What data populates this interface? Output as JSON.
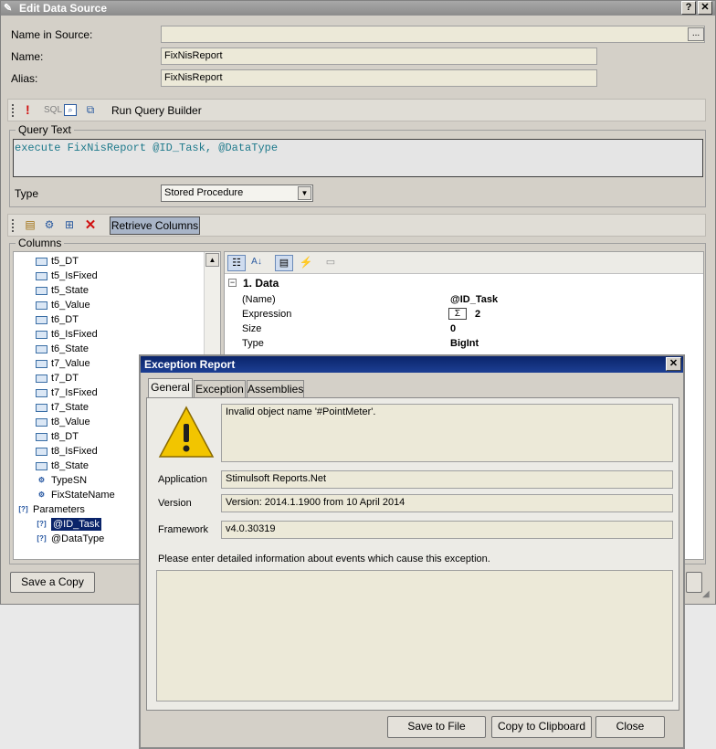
{
  "window": {
    "title": "Edit Data Source",
    "help_glyph": "?",
    "close_glyph": "✕"
  },
  "form": {
    "name_in_source_label": "Name in Source:",
    "name_in_source_value": "",
    "name_label": "Name:",
    "name_value": "FixNisReport",
    "alias_label": "Alias:",
    "alias_value": "FixNisReport",
    "browse_label": "..."
  },
  "query_toolbar": {
    "sql_label": "SQL",
    "run_query_builder_label": "Run Query Builder"
  },
  "query_text": {
    "group_label": "Query Text",
    "value": "execute FixNisReport @ID_Task, @DataType"
  },
  "type": {
    "label": "Type",
    "selected": "Stored Procedure"
  },
  "columns_toolbar": {
    "retrieve_columns_label": "Retrieve Columns"
  },
  "columns": {
    "group_label": "Columns",
    "items": [
      "t5_DT",
      "t5_IsFixed",
      "t5_State",
      "t6_Value",
      "t6_DT",
      "t6_IsFixed",
      "t6_State",
      "t7_Value",
      "t7_DT",
      "t7_IsFixed",
      "t7_State",
      "t8_Value",
      "t8_DT",
      "t8_IsFixed",
      "t8_State",
      "TypeSN",
      "FixStateName"
    ],
    "parameters_label": "Parameters",
    "parameters": [
      "@ID_Task",
      "@DataType"
    ]
  },
  "properties": {
    "category": "1. Data",
    "rows": [
      {
        "name": "(Name)",
        "value": "@ID_Task"
      },
      {
        "name": "Expression",
        "value": "2"
      },
      {
        "name": "Size",
        "value": "0"
      },
      {
        "name": "Type",
        "value": "BigInt"
      }
    ]
  },
  "footer": {
    "save_copy_label": "Save a Copy"
  },
  "dialog": {
    "title": "Exception Report",
    "tabs": [
      "General",
      "Exception",
      "Assemblies"
    ],
    "message": "Invalid object name '#PointMeter'.",
    "application_label": "Application",
    "application_value": "Stimulsoft Reports.Net",
    "version_label": "Version",
    "version_value": "Version: 2014.1.1900 from 10 April 2014",
    "framework_label": "Framework",
    "framework_value": "v4.0.30319",
    "prompt": "Please enter detailed information about events which cause this exception.",
    "details_value": "",
    "save_to_file_label": "Save to File",
    "copy_label": "Copy to Clipboard",
    "close_label": "Close"
  },
  "colors": {
    "dialog_title": "#0a246a",
    "query_text": "#1f7a8c",
    "selected_item": "#0a246a",
    "warning": "#f2c500"
  }
}
